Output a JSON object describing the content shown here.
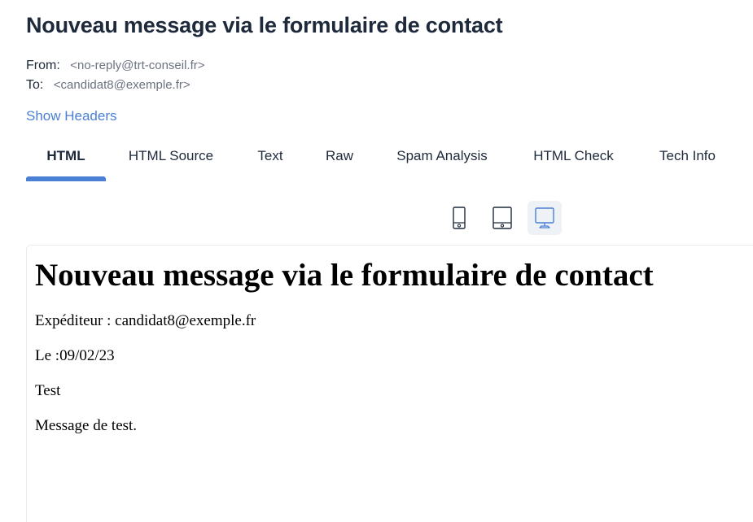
{
  "email": {
    "subject": "Nouveau message via le formulaire de contact",
    "from_label": "From:",
    "from_value": "<no-reply@trt-conseil.fr>",
    "to_label": "To:",
    "to_value": "<candidat8@exemple.fr>",
    "show_headers": "Show Headers"
  },
  "tabs": [
    {
      "label": "HTML",
      "active": true
    },
    {
      "label": "HTML Source",
      "active": false
    },
    {
      "label": "Text",
      "active": false
    },
    {
      "label": "Raw",
      "active": false
    },
    {
      "label": "Spam Analysis",
      "active": false
    },
    {
      "label": "HTML Check",
      "active": false
    },
    {
      "label": "Tech Info",
      "active": false
    }
  ],
  "device_toggle": {
    "options": [
      "mobile-icon",
      "tablet-icon",
      "desktop-icon"
    ],
    "selected": "desktop-icon"
  },
  "preview": {
    "heading": "Nouveau message via le formulaire de contact",
    "sender_line": "Expéditeur : candidat8@exemple.fr",
    "date_line": "Le :09/02/23",
    "subject_line": "Test",
    "body_line": "Message de test."
  },
  "colors": {
    "accent": "#4a7fd6",
    "text_dark": "#1e2a3b",
    "muted": "#6b7280",
    "active_device_bg": "#eef2f6"
  }
}
